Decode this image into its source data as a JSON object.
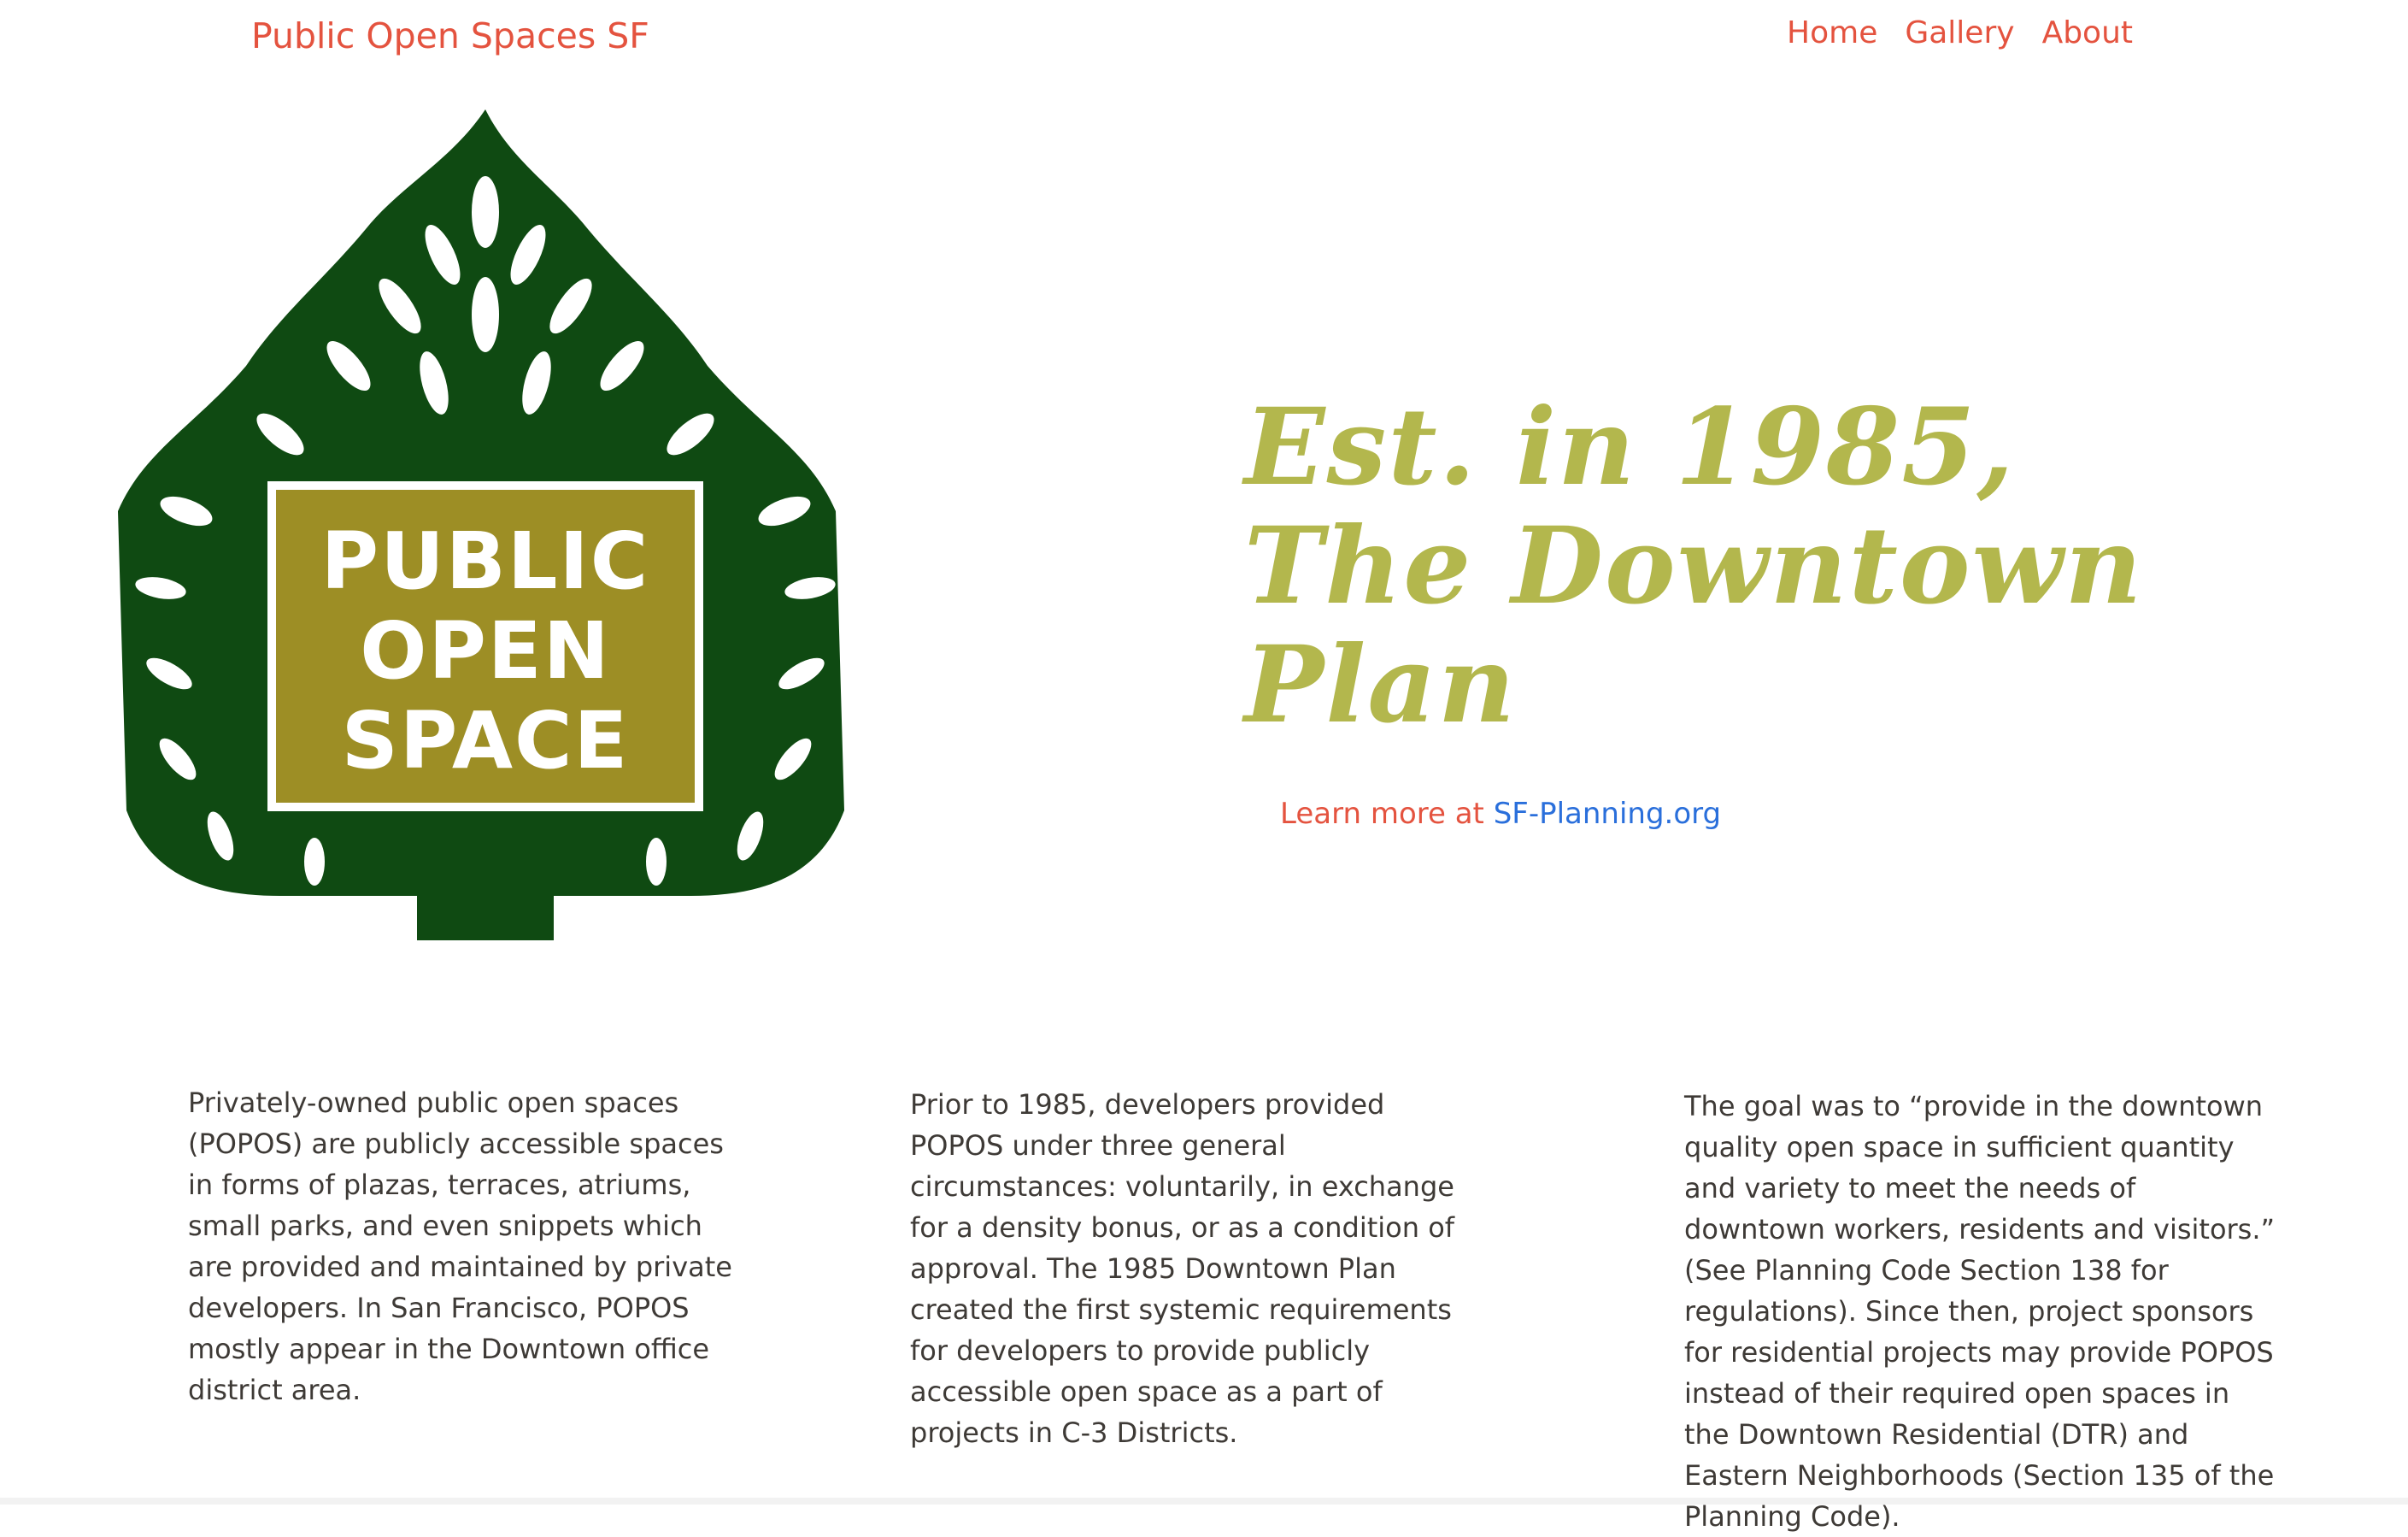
{
  "header": {
    "brand": "Public Open Spaces SF",
    "nav": {
      "home": "Home",
      "gallery": "Gallery",
      "about": "About"
    }
  },
  "logo": {
    "line1": "PUBLIC",
    "line2": "OPEN",
    "line3": "SPACE",
    "colors": {
      "tree": "#0f4a12",
      "panel": "#9d8e25"
    }
  },
  "hero": {
    "heading": "Est. in 1985, The Downtown Plan",
    "learn_prefix": "Learn more at ",
    "learn_link": "SF-Planning.org"
  },
  "columns": [
    "Privately-owned public open spaces (POPOS) are publicly accessible spaces in forms of plazas, terraces, atriums, small parks, and even snippets which are provided and maintained by private developers. In San Francisco, POPOS mostly appear in the Downtown office district area.",
    "Prior to 1985, developers provided POPOS under three general circumstances: voluntarily, in exchange for a density bonus, or as a condition of approval. The 1985 Downtown Plan created the first systemic requirements for developers to provide publicly accessible open space as a part of projects in C-3 Districts.",
    "The goal was to “provide in the downtown quality open space in sufficient quantity and variety to meet the needs of downtown workers, residents and visitors.” (See Planning Code Section 138 for regulations). Since then, project sponsors for residential projects may provide POPOS instead of their required open spaces in the Downtown Residential (DTR) and Eastern Neighborhoods (Section 135 of the Planning Code)."
  ],
  "theme": {
    "accent": "#e4533f",
    "heading_color": "#b3b74d",
    "link_color": "#2a6fdb"
  }
}
